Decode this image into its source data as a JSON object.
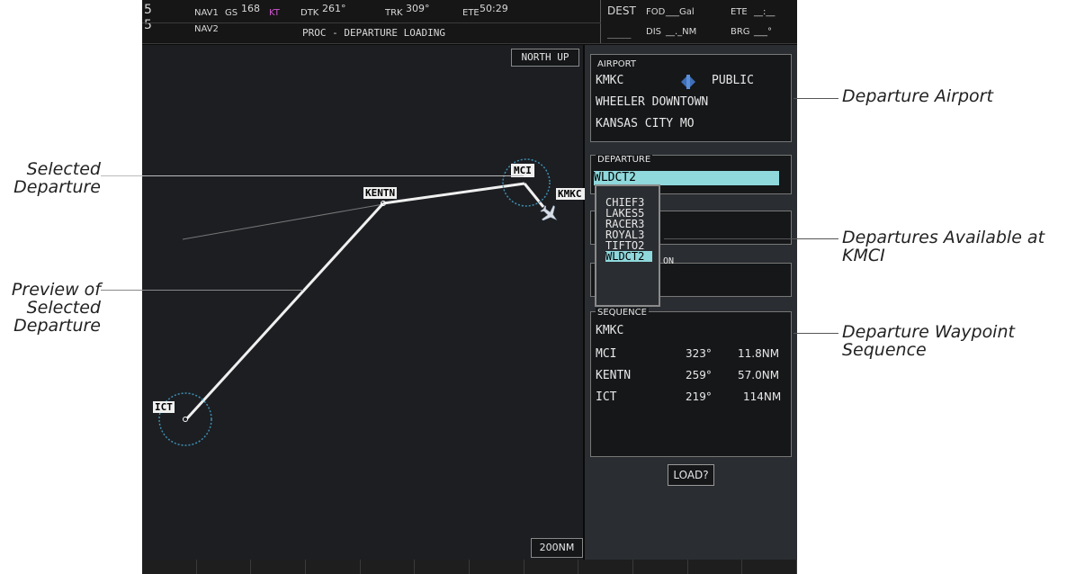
{
  "topbar": {
    "edge_top": "5",
    "edge_bottom": "5",
    "nav1": "NAV1",
    "nav2": "NAV2",
    "gs_label": "GS",
    "gs_value": "168",
    "gs_unit": "KT",
    "dtk_label": "DTK",
    "dtk_value": "261°",
    "trk_label": "TRK",
    "trk_value": "309°",
    "ete_label": "ETE",
    "ete_value": "50:29",
    "status_message": "PROC - DEPARTURE LOADING",
    "dest_label": "DEST",
    "dest_value": "____",
    "fod_label": "FOD",
    "fod_value": "___Gal",
    "ete2_label": "ETE",
    "ete2_value": "__:__",
    "dis_label": "DIS",
    "dis_value": "__._NM",
    "brg_label": "BRG",
    "brg_value": "___°"
  },
  "map": {
    "orientation": "NORTH UP",
    "range": "200NM",
    "waypoints": {
      "mci": "MCI",
      "kentn": "KENTN",
      "kmkc": "KMKC",
      "ict": "ICT"
    }
  },
  "airport": {
    "title": "AIRPORT",
    "ident": "KMKC",
    "type": "PUBLIC",
    "name": "WHEELER DOWNTOWN",
    "city": "KANSAS CITY MO"
  },
  "departure": {
    "title": "DEPARTURE",
    "selected": "WLDCT2",
    "options": [
      "CHIEF3",
      "LAKES5",
      "RACER3",
      "ROYAL3",
      "TIFTO2",
      "WLDCT2"
    ],
    "hidden_label_fragment": "ON"
  },
  "sequence": {
    "title": "SEQUENCE",
    "origin": "KMKC",
    "rows": [
      {
        "wpt": "MCI",
        "crs": "323°",
        "dist": "11.8NM"
      },
      {
        "wpt": "KENTN",
        "crs": "259°",
        "dist": "57.0NM"
      },
      {
        "wpt": "ICT",
        "crs": "219°",
        "dist": "114NM"
      }
    ]
  },
  "load_button": "LOAD?",
  "callouts": {
    "departure_airport": "Departure Airport",
    "selected_departure_1": "Selected",
    "selected_departure_2": "Departure",
    "available_1": "Departures Available at",
    "available_2": "KMCI",
    "preview_1": "Preview of",
    "preview_2": "Selected",
    "preview_3": "Departure",
    "sequence_1": "Departure Waypoint",
    "sequence_2": "Sequence"
  },
  "colors": {
    "magenta": "#cc55cc",
    "cyan_highlight": "#8fd8dc",
    "route_white": "#f0f0f0",
    "range_ring_cyan": "#3f8fb0"
  }
}
